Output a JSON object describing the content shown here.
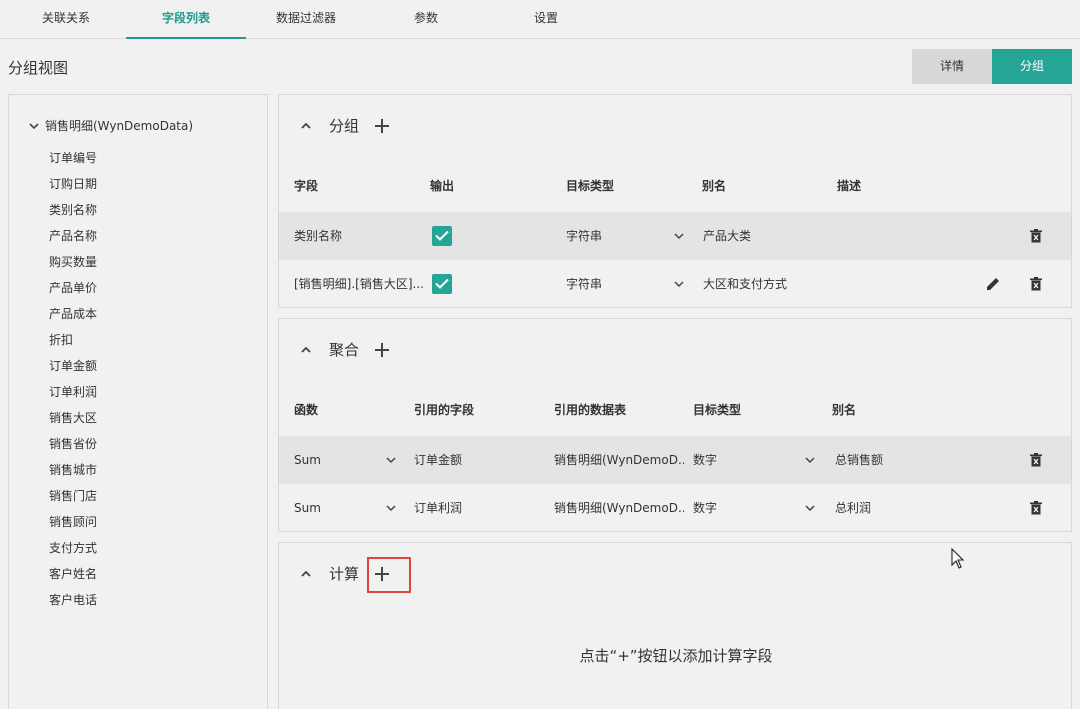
{
  "tabs": [
    {
      "label": "关联关系"
    },
    {
      "label": "字段列表",
      "active": true
    },
    {
      "label": "数据过滤器"
    },
    {
      "label": "参数"
    },
    {
      "label": "设置"
    }
  ],
  "view_title": "分组视图",
  "view_toggle": {
    "detail": "详情",
    "group": "分组",
    "selected": "分组"
  },
  "tree": {
    "root": "销售明细(WynDemoData)",
    "items": [
      "订单编号",
      "订购日期",
      "类别名称",
      "产品名称",
      "购买数量",
      "产品单价",
      "产品成本",
      "折扣",
      "订单金额",
      "订单利润",
      "销售大区",
      "销售省份",
      "销售城市",
      "销售门店",
      "销售顾问",
      "支付方式",
      "客户姓名",
      "客户电话"
    ]
  },
  "group_section": {
    "title": "分组",
    "headers": {
      "field": "字段",
      "output": "输出",
      "target_type": "目标类型",
      "alias": "别名",
      "desc": "描述"
    },
    "rows": [
      {
        "field": "类别名称",
        "output_checked": true,
        "target_type": "字符串",
        "alias": "产品大类"
      },
      {
        "field": "[销售明细].[销售大区]...",
        "output_checked": true,
        "target_type": "字符串",
        "alias": "大区和支付方式"
      }
    ]
  },
  "agg_section": {
    "title": "聚合",
    "headers": {
      "func": "函数",
      "ref_field": "引用的字段",
      "ref_table": "引用的数据表",
      "target_type": "目标类型",
      "alias": "别名"
    },
    "rows": [
      {
        "func": "Sum",
        "ref_field": "订单金额",
        "ref_table": "销售明细(WynDemoD...",
        "target_type": "数字",
        "alias": "总销售额"
      },
      {
        "func": "Sum",
        "ref_field": "订单利润",
        "ref_table": "销售明细(WynDemoD...",
        "target_type": "数字",
        "alias": "总利润"
      }
    ]
  },
  "calc_section": {
    "title": "计算",
    "empty_hint": "点击“+”按钮以添加计算字段"
  },
  "colors": {
    "accent": "#25a596",
    "highlight": "#e0463f"
  }
}
